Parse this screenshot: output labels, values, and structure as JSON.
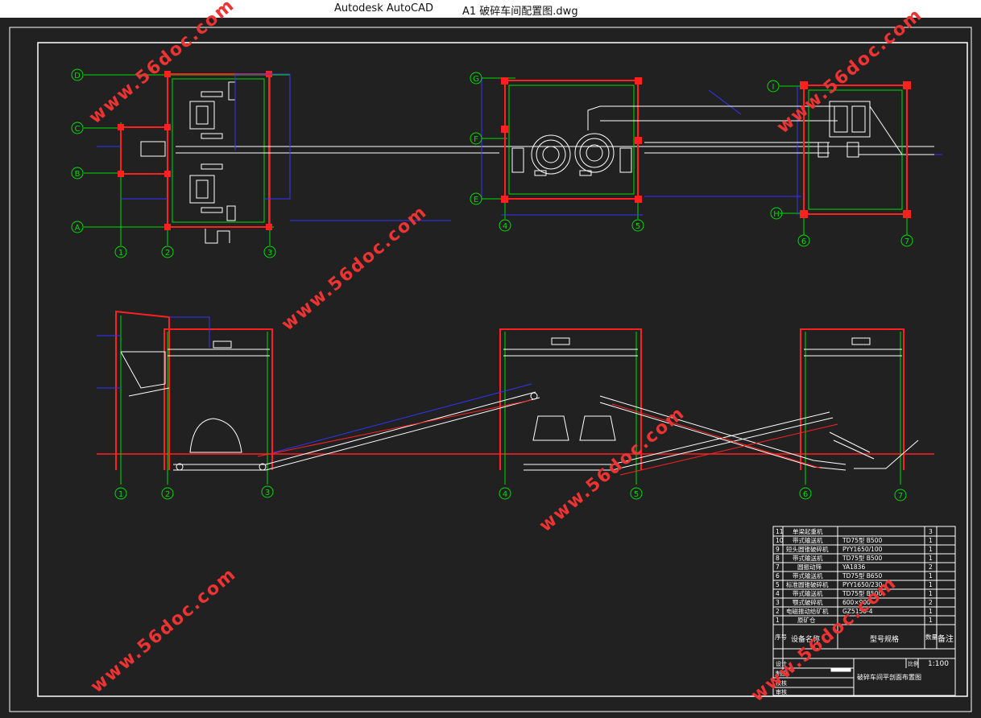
{
  "window": {
    "app_title": "Autodesk AutoCAD",
    "file_title": "A1  破碎车间配置图.dwg"
  },
  "plan_view": {
    "row_labels": [
      "D",
      "C",
      "B",
      "A",
      "G",
      "F",
      "E",
      "I",
      "H"
    ],
    "col_labels": [
      "1",
      "2",
      "3",
      "4",
      "5",
      "6",
      "7"
    ]
  },
  "section_view": {
    "col_labels": [
      "1",
      "2",
      "3",
      "4",
      "5",
      "6",
      "7"
    ]
  },
  "bom": {
    "rows": [
      {
        "no": "11",
        "name": "单梁起重机",
        "spec": "",
        "qty": "3"
      },
      {
        "no": "10",
        "name": "带式输送机",
        "spec": "TD75型 B500",
        "qty": "1"
      },
      {
        "no": "9",
        "name": "短头圆锥破碎机",
        "spec": "PYY1650/100",
        "qty": "1"
      },
      {
        "no": "8",
        "name": "带式输送机",
        "spec": "TD75型 B500",
        "qty": "1"
      },
      {
        "no": "7",
        "name": "圆振动筛",
        "spec": "YA1836",
        "qty": "2"
      },
      {
        "no": "6",
        "name": "带式输送机",
        "spec": "TD75型 B650",
        "qty": "1"
      },
      {
        "no": "5",
        "name": "标准圆锥破碎机",
        "spec": "PYY1650/230",
        "qty": "1"
      },
      {
        "no": "4",
        "name": "带式输送机",
        "spec": "TD75型 B500",
        "qty": "1"
      },
      {
        "no": "3",
        "name": "颚式破碎机",
        "spec": "600×900",
        "qty": "2"
      },
      {
        "no": "2",
        "name": "电磁振动给矿机",
        "spec": "GZ5150-4",
        "qty": "1"
      },
      {
        "no": "1",
        "name": "原矿仓",
        "spec": "",
        "qty": "1"
      }
    ],
    "header": {
      "no": "序号",
      "name": "设备名称",
      "spec": "型号规格",
      "qty": "数量",
      "note": "备注"
    }
  },
  "title_block": {
    "drawing_name": "破碎车间平剖面布置图",
    "scale_label": "比例",
    "scale_value": "1:100",
    "rows": [
      "设计",
      "制图",
      "校核",
      "审核"
    ]
  },
  "watermark": "www.56doc.com",
  "colors": {
    "background": "#212121",
    "wall_red": "#ff2020",
    "grid_green": "#00ff00",
    "dim_blue": "#3333ff",
    "lines_white": "#ffffff"
  }
}
